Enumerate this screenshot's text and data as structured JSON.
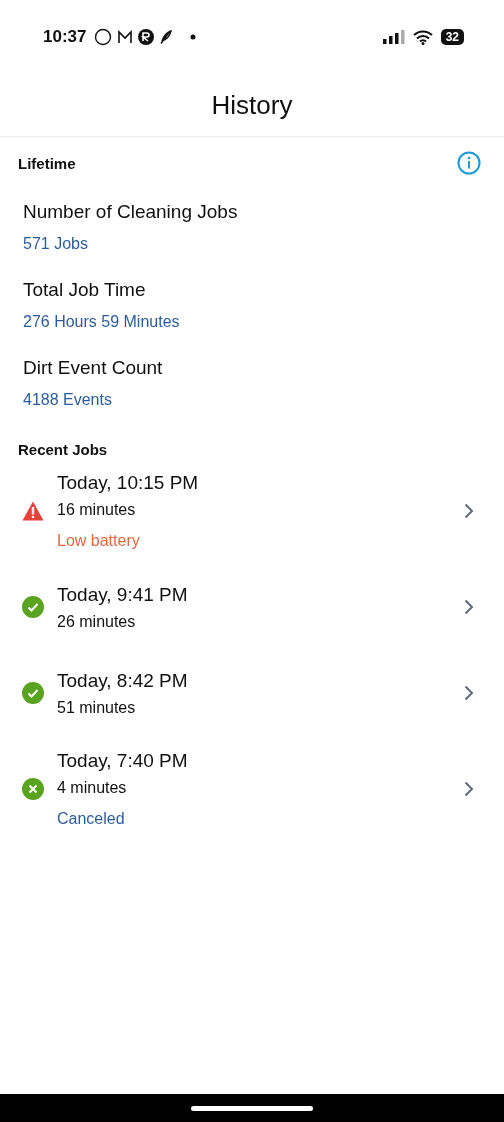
{
  "status_bar": {
    "time": "10:37",
    "battery": "32"
  },
  "title": "History",
  "lifetime": {
    "heading": "Lifetime",
    "stats": [
      {
        "label": "Number of Cleaning Jobs",
        "value": "571 Jobs"
      },
      {
        "label": "Total Job Time",
        "value": "276 Hours 59 Minutes"
      },
      {
        "label": "Dirt Event Count",
        "value": "4188 Events"
      }
    ]
  },
  "recent": {
    "heading": "Recent Jobs",
    "jobs": [
      {
        "kind": "warning",
        "time": "Today, 10:15 PM",
        "duration": "16 minutes",
        "note": "Low battery"
      },
      {
        "kind": "done",
        "time": "Today, 9:41 PM",
        "duration": "26 minutes"
      },
      {
        "kind": "done",
        "time": "Today, 8:42 PM",
        "duration": "51 minutes"
      },
      {
        "kind": "canceled",
        "time": "Today, 7:40 PM",
        "duration": "4 minutes",
        "note": "Canceled"
      }
    ]
  }
}
